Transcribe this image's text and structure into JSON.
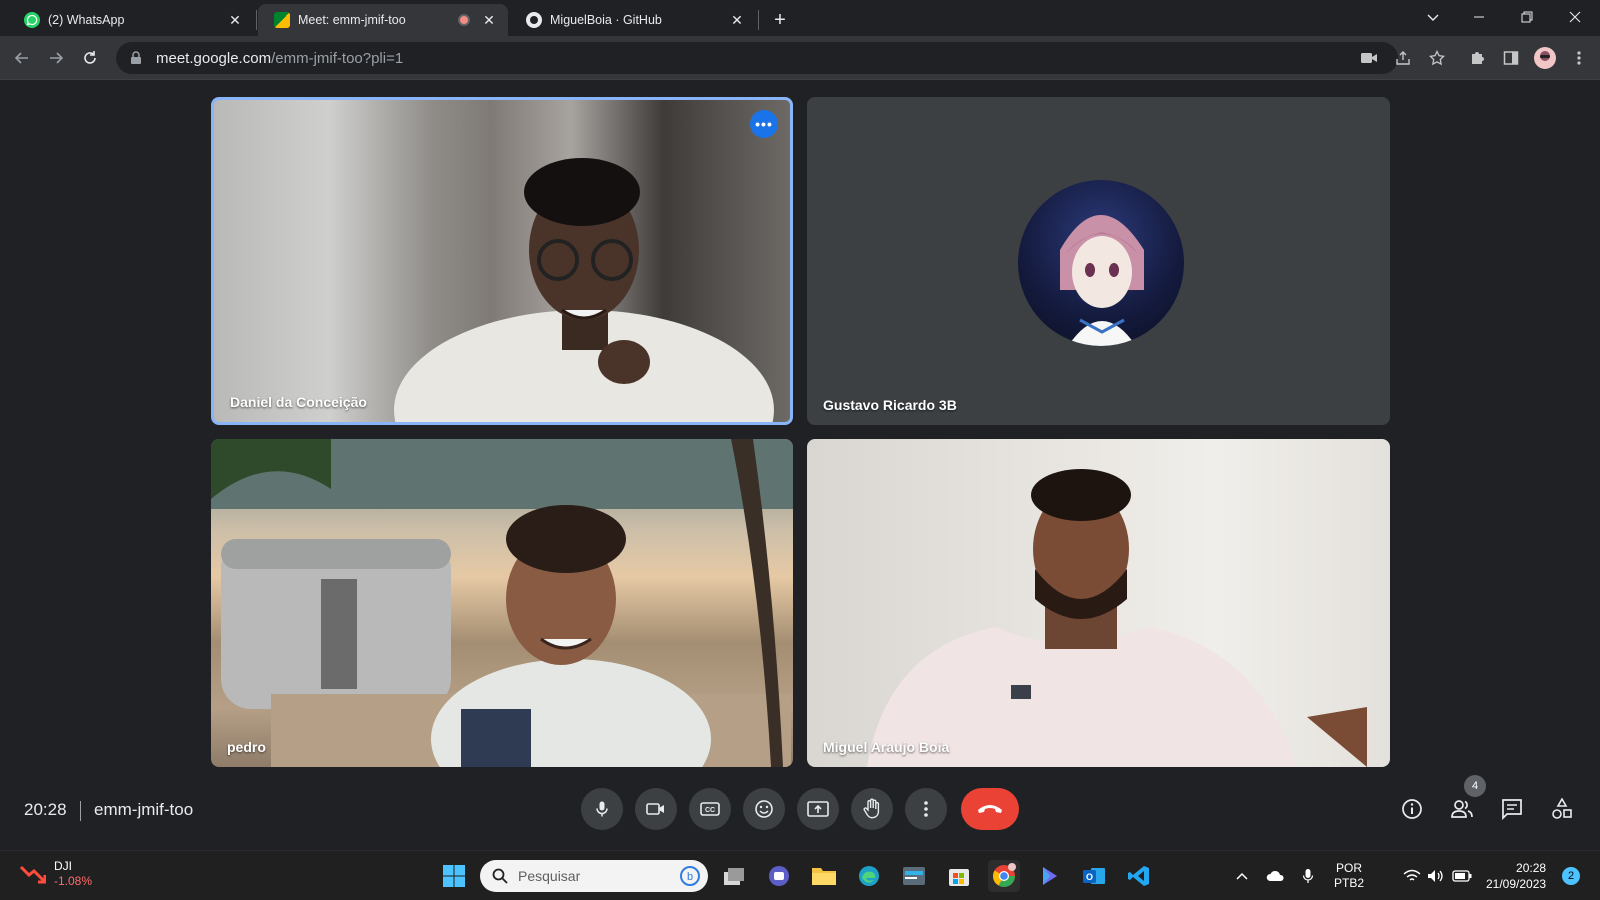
{
  "browser": {
    "tabs": [
      {
        "label": "(2) WhatsApp",
        "icon": "whatsapp-icon",
        "active": false
      },
      {
        "label": "Meet: emm-jmif-too",
        "icon": "google-meet-icon",
        "active": true
      },
      {
        "label": "MiguelBoia · GitHub",
        "icon": "github-icon",
        "active": false
      }
    ],
    "url_host": "meet.google.com",
    "url_path": "/emm-jmif-too?pli=1"
  },
  "meet": {
    "participants": [
      {
        "name": "Daniel da Conceição",
        "speaking": true
      },
      {
        "name": "Gustavo Ricardo 3B",
        "camera_off": true
      },
      {
        "name": "pedro"
      },
      {
        "name": "Miguel Araujo Boia"
      }
    ],
    "meeting_time": "20:28",
    "meeting_code": "emm-jmif-too",
    "participant_count": "4",
    "end_call_color": "#ea4335",
    "active_speaker_color": "#8ab4f8"
  },
  "taskbar": {
    "stock_name": "DJI",
    "stock_change": "-1.08%",
    "search_placeholder": "Pesquisar",
    "language": "POR",
    "keyboard": "PTB2",
    "time": "20:28",
    "date": "21/09/2023",
    "notification_count": "2"
  }
}
